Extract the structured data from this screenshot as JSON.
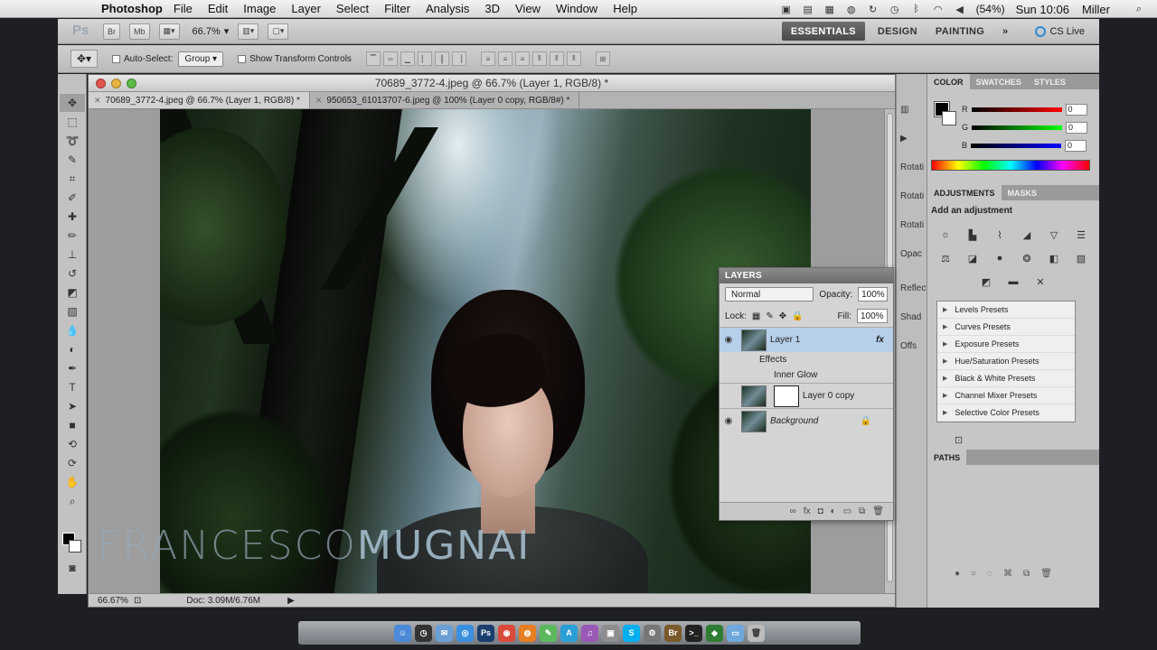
{
  "menubar": {
    "app": "Photoshop",
    "menus": [
      "File",
      "Edit",
      "Image",
      "Layer",
      "Select",
      "Filter",
      "Analysis",
      "3D",
      "View",
      "Window",
      "Help"
    ],
    "battery": "(54%)",
    "clock": "Sun 10:06",
    "user": "Miller"
  },
  "appbar": {
    "logo": "Ps",
    "bridge_btn": "Br",
    "minibridge_btn": "Mb",
    "zoom": "66.7%",
    "workspaces": [
      "ESSENTIALS",
      "DESIGN",
      "PAINTING"
    ],
    "more": "»",
    "cs_live": "CS Live"
  },
  "options": {
    "auto_select_label": "Auto-Select:",
    "auto_select_value": "Group",
    "show_transform_label": "Show Transform Controls"
  },
  "document": {
    "title": "70689_3772-4.jpeg @ 66.7% (Layer 1, RGB/8) *",
    "tabs": [
      {
        "label": "70689_3772-4.jpeg @ 66.7% (Layer 1, RGB/8) *",
        "active": true
      },
      {
        "label": "950653_61013707-6.jpeg @ 100% (Layer 0 copy, RGB/8#) *",
        "active": false
      }
    ],
    "watermark_light": "FRANCESCO",
    "watermark_bold": "MUGNAI",
    "status_zoom": "66.67%",
    "status_doc": "Doc: 3.09M/6.76M"
  },
  "layers": {
    "title": "LAYERS",
    "blend_mode": "Normal",
    "opacity_label": "Opacity:",
    "opacity": "100%",
    "lock_label": "Lock:",
    "fill_label": "Fill:",
    "fill": "100%",
    "items": [
      {
        "name": "Layer 1",
        "fx": "fx"
      },
      {
        "name": "Effects"
      },
      {
        "name": "Inner Glow"
      },
      {
        "name": "Layer 0 copy"
      },
      {
        "name": "Background"
      }
    ]
  },
  "dock_strip": {
    "items": [
      "Rotati",
      "Rotati",
      "Rotati",
      "Opac",
      "Reflect",
      "Shad",
      "Offs"
    ]
  },
  "color_panel": {
    "tabs": [
      "COLOR",
      "SWATCHES",
      "STYLES"
    ],
    "r_label": "R",
    "g_label": "G",
    "b_label": "B",
    "r": "0",
    "g": "0",
    "b": "0"
  },
  "adjustments": {
    "tabs": [
      "ADJUSTMENTS",
      "MASKS"
    ],
    "title": "Add an adjustment",
    "presets": [
      "Levels Presets",
      "Curves Presets",
      "Exposure Presets",
      "Hue/Saturation Presets",
      "Black & White Presets",
      "Channel Mixer Presets",
      "Selective Color Presets"
    ]
  },
  "paths": {
    "title": "PATHS"
  }
}
